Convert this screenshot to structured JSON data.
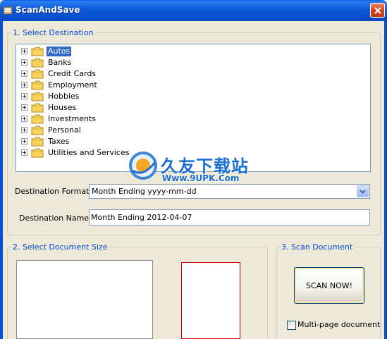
{
  "window": {
    "title": "ScanAndSave"
  },
  "destination": {
    "group_label": "1. Select Destination",
    "folders": [
      {
        "label": "Autos",
        "selected": true
      },
      {
        "label": "Banks"
      },
      {
        "label": "Credit Cards"
      },
      {
        "label": "Employment"
      },
      {
        "label": "Hobbies"
      },
      {
        "label": "Houses"
      },
      {
        "label": "Investments"
      },
      {
        "label": "Personal"
      },
      {
        "label": "Taxes"
      },
      {
        "label": "Utilities and Services"
      }
    ],
    "format_label": "Destination Format:",
    "format_value": "Month Ending yyyy-mm-dd",
    "name_label": "Destination Name:",
    "name_value": "Month Ending 2012-04-07"
  },
  "document_size": {
    "group_label": "2. Select Document Size"
  },
  "scan": {
    "group_label": "3. Scan Document",
    "scan_button_label": "SCAN NOW!",
    "multipage_label": "Multi-page document",
    "multipage_checked": false
  },
  "watermark": {
    "line1": "久友下载站",
    "line2": "Www.9UPK.Com"
  },
  "colors": {
    "titlebar": "#0A4FD0",
    "selection": "#316AC5",
    "group_label": "#0046D5",
    "window_bg": "#ECE9D8",
    "doc_size_selected_border": "#D00000"
  }
}
